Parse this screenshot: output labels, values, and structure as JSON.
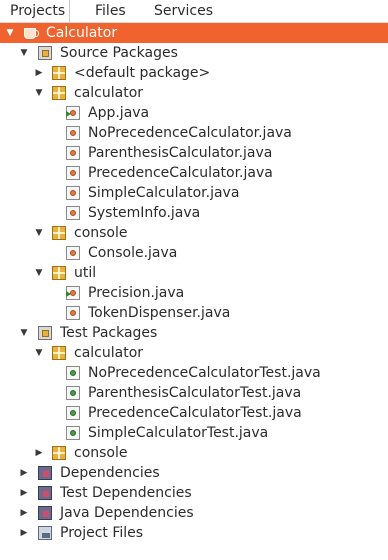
{
  "tabs": [
    "Projects",
    "Files",
    "Services"
  ],
  "tree": [
    {
      "label": "Calculator",
      "icon": "project-icon",
      "expanded": true,
      "selected": true
    },
    {
      "label": "Source Packages",
      "icon": "source-packages-icon",
      "expanded": true
    },
    {
      "label": "<default package>",
      "icon": "package-icon",
      "expanded": false
    },
    {
      "label": "calculator",
      "icon": "package-icon",
      "expanded": true
    },
    {
      "label": "App.java",
      "icon": "java-main-class-icon"
    },
    {
      "label": "NoPrecedenceCalculator.java",
      "icon": "java-class-icon"
    },
    {
      "label": "ParenthesisCalculator.java",
      "icon": "java-class-icon"
    },
    {
      "label": "PrecedenceCalculator.java",
      "icon": "java-class-icon"
    },
    {
      "label": "SimpleCalculator.java",
      "icon": "java-class-icon"
    },
    {
      "label": "SystemInfo.java",
      "icon": "java-class-icon"
    },
    {
      "label": "console",
      "icon": "package-icon",
      "expanded": true
    },
    {
      "label": "Console.java",
      "icon": "java-class-icon"
    },
    {
      "label": "util",
      "icon": "package-icon",
      "expanded": true
    },
    {
      "label": "Precision.java",
      "icon": "java-main-class-icon"
    },
    {
      "label": "TokenDispenser.java",
      "icon": "java-class-icon"
    },
    {
      "label": "Test Packages",
      "icon": "test-packages-icon",
      "expanded": true
    },
    {
      "label": "calculator",
      "icon": "package-icon",
      "expanded": true
    },
    {
      "label": "NoPrecedenceCalculatorTest.java",
      "icon": "java-test-class-icon"
    },
    {
      "label": "ParenthesisCalculatorTest.java",
      "icon": "java-test-class-icon"
    },
    {
      "label": "PrecedenceCalculatorTest.java",
      "icon": "java-test-class-icon"
    },
    {
      "label": "SimpleCalculatorTest.java",
      "icon": "java-test-class-icon"
    },
    {
      "label": "console",
      "icon": "package-icon",
      "expanded": false
    },
    {
      "label": "Dependencies",
      "icon": "dependencies-icon",
      "expanded": false
    },
    {
      "label": "Test Dependencies",
      "icon": "dependencies-icon",
      "expanded": false
    },
    {
      "label": "Java Dependencies",
      "icon": "java-dependencies-icon",
      "expanded": false
    },
    {
      "label": "Project Files",
      "icon": "project-files-icon",
      "expanded": false
    }
  ],
  "colors": {
    "selection": "#f0632f",
    "package": "#e8b040"
  }
}
